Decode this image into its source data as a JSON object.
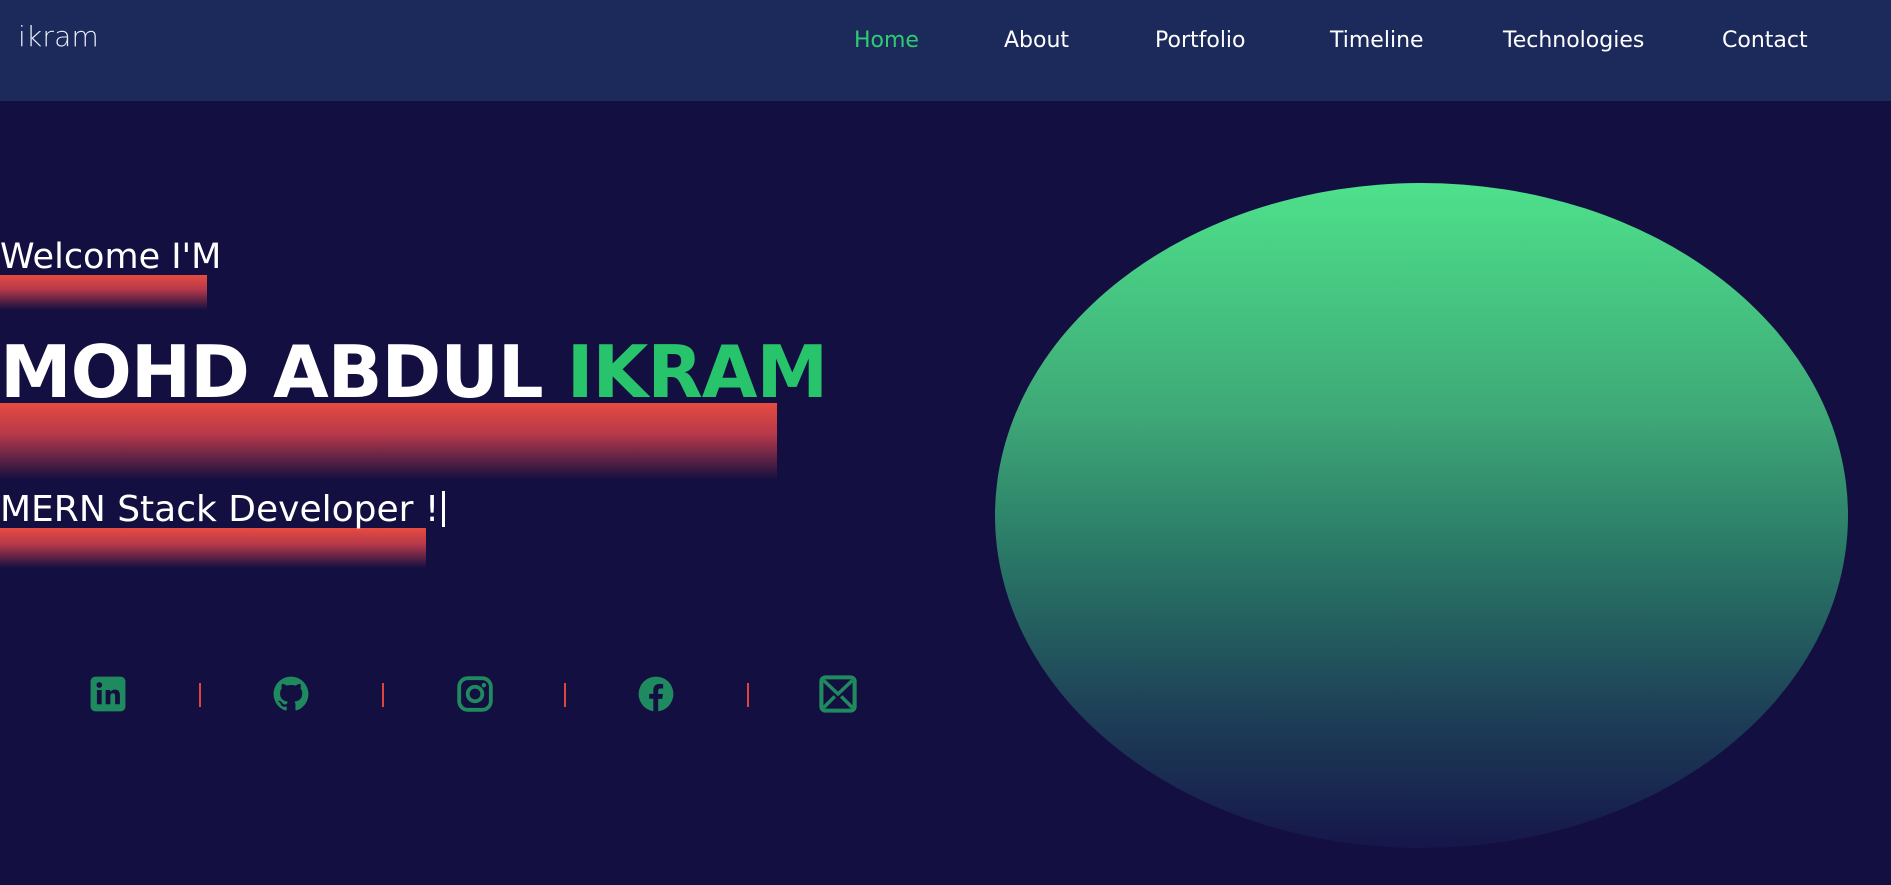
{
  "nav": {
    "brand": "ikram",
    "links": [
      {
        "label": "Home",
        "active": true
      },
      {
        "label": "About",
        "active": false
      },
      {
        "label": "Portfolio",
        "active": false
      },
      {
        "label": "Timeline",
        "active": false
      },
      {
        "label": "Technologies",
        "active": false
      },
      {
        "label": "Contact",
        "active": false
      }
    ]
  },
  "hero": {
    "welcome": "Welcome I'M",
    "name_first": "MOHD ABDUL",
    "name_accent": "IKRAM",
    "role": "MERN Stack Developer !"
  },
  "socials": [
    {
      "icon": "linkedin-icon"
    },
    {
      "icon": "github-icon"
    },
    {
      "icon": "instagram-icon"
    },
    {
      "icon": "facebook-icon"
    },
    {
      "icon": "mail-icon"
    }
  ],
  "colors": {
    "background": "#130f40",
    "navbar": "#1b2a5a",
    "accent_green": "#27c46b",
    "underline_red": "#e64c3f",
    "icon_green": "#1f8a5f",
    "separator_red": "#e0443e"
  }
}
